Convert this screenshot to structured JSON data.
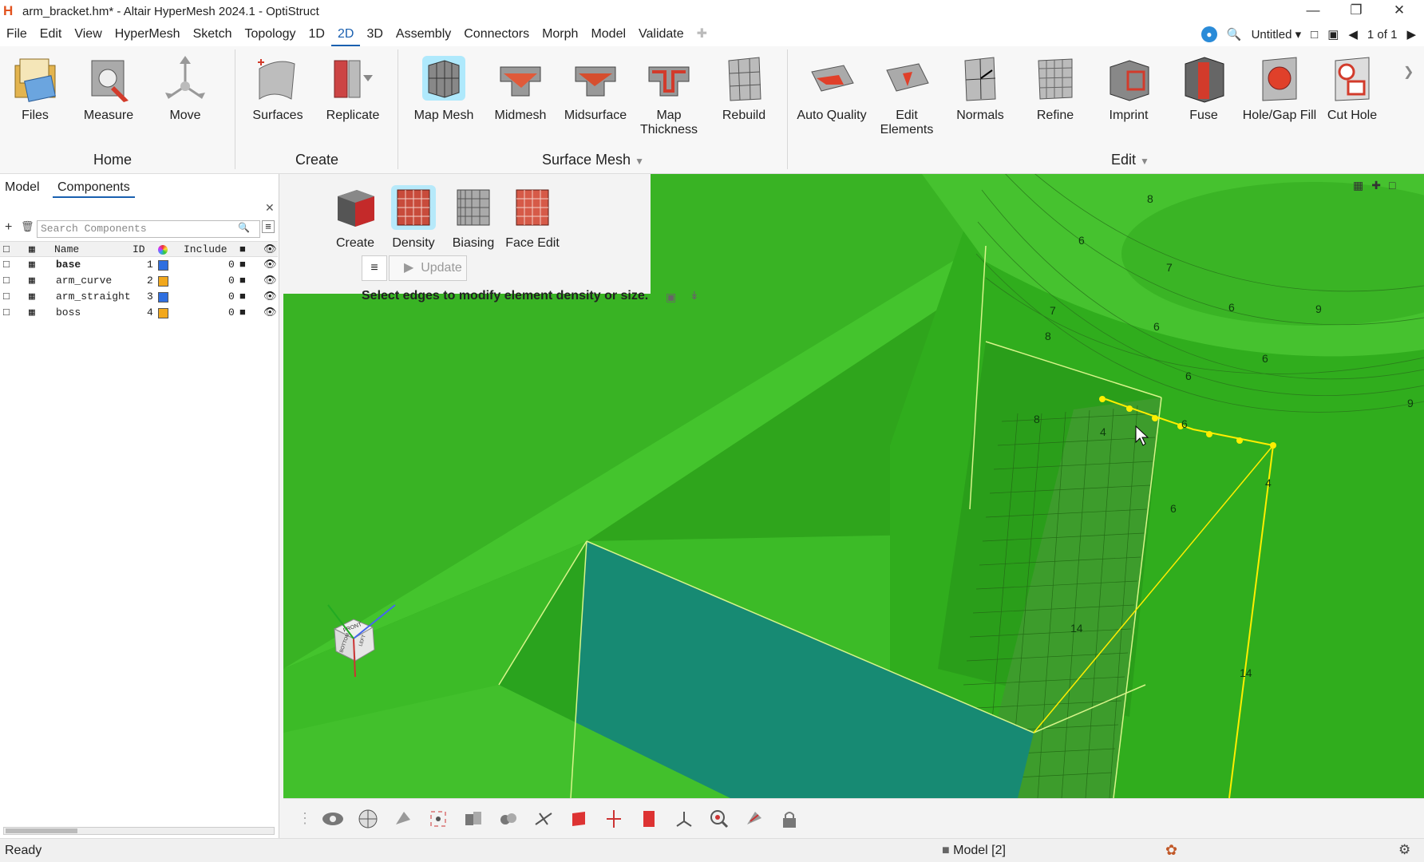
{
  "window": {
    "title": "arm_bracket.hm* - Altair HyperMesh 2024.1 - OptiStruct",
    "logo_letter": "H"
  },
  "menubar": {
    "items": [
      "File",
      "Edit",
      "View",
      "HyperMesh",
      "Sketch",
      "Topology",
      "1D",
      "2D",
      "3D",
      "Assembly",
      "Connectors",
      "Morph",
      "Model",
      "Validate"
    ],
    "active": "2D",
    "session_name": "Untitled",
    "page_indicator": "1 of 1"
  },
  "ribbon": {
    "tools": [
      {
        "label": "Files",
        "icon": "files-icon"
      },
      {
        "label": "Measure",
        "icon": "measure-icon"
      },
      {
        "label": "Move",
        "icon": "move-icon"
      },
      {
        "label": "Surfaces",
        "icon": "surfaces-icon"
      },
      {
        "label": "Replicate",
        "icon": "replicate-icon"
      },
      {
        "label": "Map Mesh",
        "icon": "map-mesh-icon"
      },
      {
        "label": "Midmesh",
        "icon": "midmesh-icon"
      },
      {
        "label": "Midsurface",
        "icon": "midsurface-icon"
      },
      {
        "label": "Map Thickness",
        "icon": "map-thickness-icon"
      },
      {
        "label": "Rebuild",
        "icon": "rebuild-icon"
      },
      {
        "label": "Auto Quality",
        "icon": "auto-quality-icon"
      },
      {
        "label": "Edit Elements",
        "icon": "edit-elements-icon"
      },
      {
        "label": "Normals",
        "icon": "normals-icon"
      },
      {
        "label": "Refine",
        "icon": "refine-icon"
      },
      {
        "label": "Imprint",
        "icon": "imprint-icon"
      },
      {
        "label": "Fuse",
        "icon": "fuse-icon"
      },
      {
        "label": "Hole/Gap Fill",
        "icon": "hole-gap-fill-icon"
      },
      {
        "label": "Cut Hole",
        "icon": "cut-hole-icon"
      }
    ],
    "groups": [
      "Home",
      "Create",
      "Surface Mesh",
      "Edit"
    ]
  },
  "left_panel": {
    "tabs": [
      "Model",
      "Components"
    ],
    "active_tab": "Components",
    "search_placeholder": "Search Components",
    "columns": {
      "name": "Name",
      "id": "ID",
      "include": "Include"
    },
    "rows": [
      {
        "name": "base",
        "id": "1",
        "color": "#2f6fe0",
        "include": "0",
        "bold": true
      },
      {
        "name": "arm_curve",
        "id": "2",
        "color": "#f2a81d",
        "include": "0",
        "bold": false
      },
      {
        "name": "arm_straight",
        "id": "3",
        "color": "#2f6fe0",
        "include": "0",
        "bold": false
      },
      {
        "name": "boss",
        "id": "4",
        "color": "#f2a81d",
        "include": "0",
        "bold": false
      }
    ]
  },
  "density_toolbar": {
    "tools": [
      "Create",
      "Density",
      "Biasing",
      "Face Edit"
    ],
    "active": "Density",
    "update_label": "Update",
    "hint": "Select edges to modify element density or size."
  },
  "viewport": {
    "edge_labels": [
      "8",
      "6",
      "7",
      "6",
      "9",
      "7",
      "8",
      "6",
      "6",
      "6",
      "9",
      "8",
      "4",
      "6",
      "4",
      "6",
      "14",
      "14"
    ],
    "view_cube": {
      "front": "FRONT",
      "bottom": "BOTTOM",
      "left": "LEFT"
    }
  },
  "status": {
    "left": "Ready",
    "model": "Model [2]"
  },
  "colors": {
    "accent": "#1a60b0",
    "mesh_green": "#34b21f",
    "face_teal": "#148c78",
    "selection_yellow": "#ffee00"
  }
}
